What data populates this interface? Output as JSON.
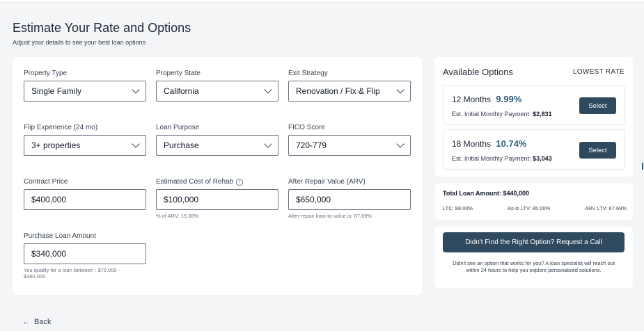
{
  "header": {
    "title": "Estimate Your Rate and Options",
    "subtitle": "Adjust your details to see your best loan options"
  },
  "form": {
    "property_type": {
      "label": "Property Type",
      "value": "Single Family"
    },
    "property_state": {
      "label": "Property State",
      "value": "California"
    },
    "exit_strategy": {
      "label": "Exit Strategy",
      "value": "Renovation / Fix & Flip"
    },
    "flip_experience": {
      "label": "Flip Experience (24 mo)",
      "value": "3+ properties"
    },
    "loan_purpose": {
      "label": "Loan Purpose",
      "value": "Purchase"
    },
    "fico_score": {
      "label": "FICO Score",
      "value": "720-779"
    },
    "contract_price": {
      "label": "Contract Price",
      "value": "$400,000"
    },
    "rehab_cost": {
      "label": "Estimated Cost of Rehab",
      "value": "$100,000",
      "hint": "% of ARV: 15.38%"
    },
    "arv": {
      "label": "After Repair Value (ARV)",
      "value": "$650,000",
      "hint": "After-repair loan-to-value is: 67.69%"
    },
    "purchase_loan_amount": {
      "label": "Purchase Loan Amount",
      "value": "$340,000",
      "hint_line1": "You qualify for a loan between : $75,000 -",
      "hint_line2": "$360,000"
    }
  },
  "options": {
    "title": "Available Options",
    "sort_label": "LOWEST RATE",
    "items": [
      {
        "term": "12 Months",
        "rate": "9.99%",
        "payment_label": "Est. Initial Monthly Payment:",
        "payment": "$2,831",
        "button": "Select"
      },
      {
        "term": "18 Months",
        "rate": "10.74%",
        "payment_label": "Est. Initial Monthly Payment:",
        "payment": "$3,043",
        "button": "Select"
      }
    ]
  },
  "totals": {
    "label": "Total Loan Amount:",
    "amount": "$440,000",
    "ltc": "LTC: 88.00%",
    "as_is_ltv": "As-is LTV: 85.00%",
    "arv_ltv": "ARV LTV: 67.69%"
  },
  "call": {
    "button": "Didn't Find the Right Option? Request a Call",
    "text": "Didn't see an option that works for you? A loan specialist will reach out within 24 hours to help you explore personalized solutions."
  },
  "nav": {
    "back_label": "Back",
    "back_icon": "arrow-left-icon"
  },
  "colors": {
    "accent": "#2f4a5e",
    "rate": "#2f5c7a",
    "background": "#f4f5f7"
  }
}
